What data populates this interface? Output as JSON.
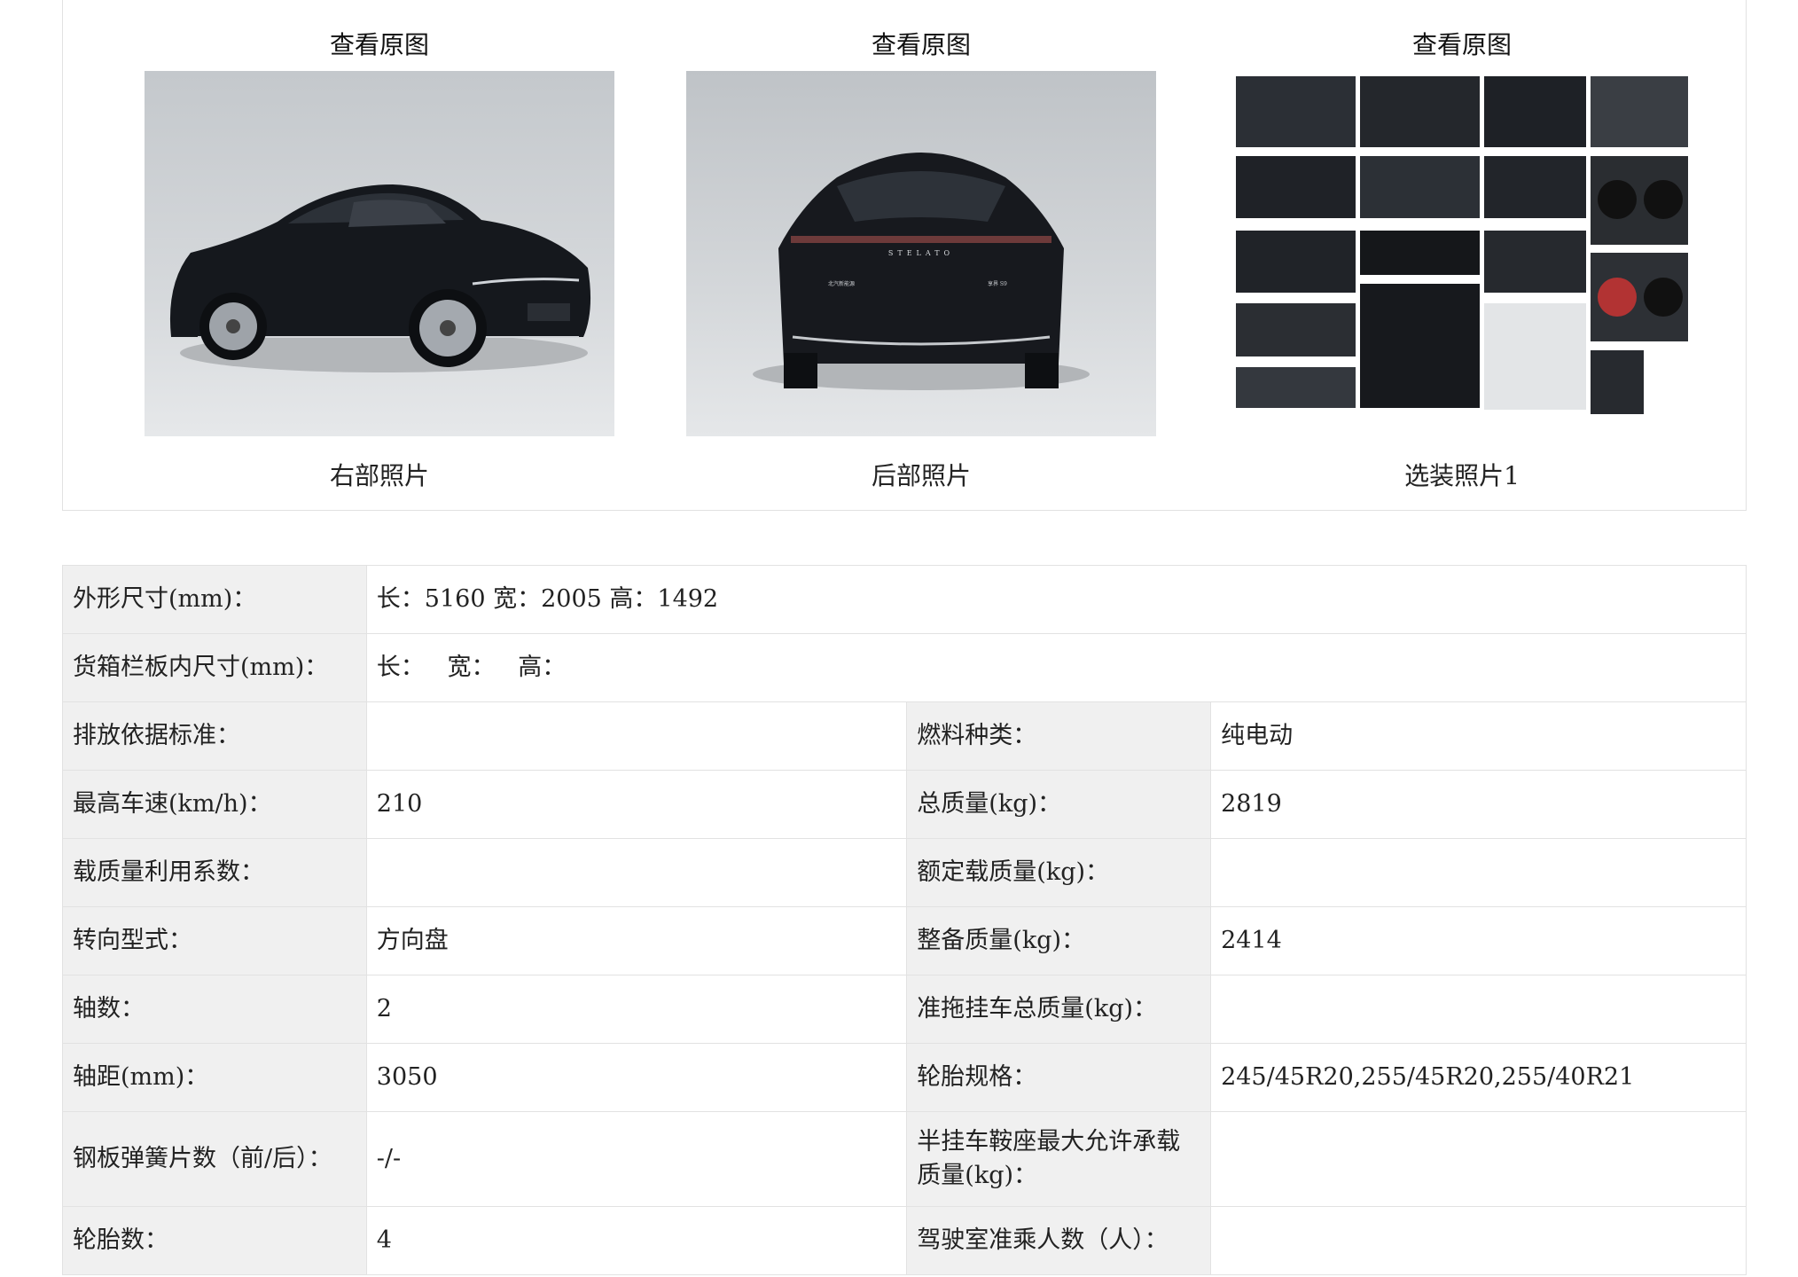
{
  "photos": [
    {
      "view_label": "查看原图",
      "caption": "右部照片"
    },
    {
      "view_label": "查看原图",
      "caption": "后部照片"
    },
    {
      "view_label": "查看原图",
      "caption": "选装照片1"
    }
  ],
  "rear_badge": {
    "brand": "STELATO",
    "left_text": "北汽新能源",
    "right_text": "享界 S9"
  },
  "spec": {
    "dims_label": "外形尺寸(mm)：",
    "dims_value": "长：5160 宽：2005 高：1492",
    "cargo_label": "货箱栏板内尺寸(mm)：",
    "cargo_value": "长：   宽：   高：",
    "emission_label": "排放依据标准：",
    "emission_value": "",
    "fuel_label": "燃料种类：",
    "fuel_value": "纯电动",
    "speed_label": "最高车速(km/h)：",
    "speed_value": "210",
    "total_mass_label": "总质量(kg)：",
    "total_mass_value": "2819",
    "load_coef_label": "载质量利用系数：",
    "load_coef_value": "",
    "rated_load_label": "额定载质量(kg)：",
    "rated_load_value": "",
    "steering_label": "转向型式：",
    "steering_value": "方向盘",
    "curb_mass_label": "整备质量(kg)：",
    "curb_mass_value": "2414",
    "axles_label": "轴数：",
    "axles_value": "2",
    "trailer_label": "准拖挂车总质量(kg)：",
    "trailer_value": "",
    "wheelbase_label": "轴距(mm)：",
    "wheelbase_value": "3050",
    "tire_spec_label": "轮胎规格：",
    "tire_spec_value": "245/45R20,255/45R20,255/40R21",
    "spring_label": "钢板弹簧片数（前/后）：",
    "spring_value": "-/-",
    "saddle_label": "半挂车鞍座最大允许承载质量(kg)：",
    "saddle_value": "",
    "tires_label": "轮胎数：",
    "tires_value": "4",
    "cab_label": "驾驶室准乘人数（人）：",
    "cab_value": ""
  }
}
